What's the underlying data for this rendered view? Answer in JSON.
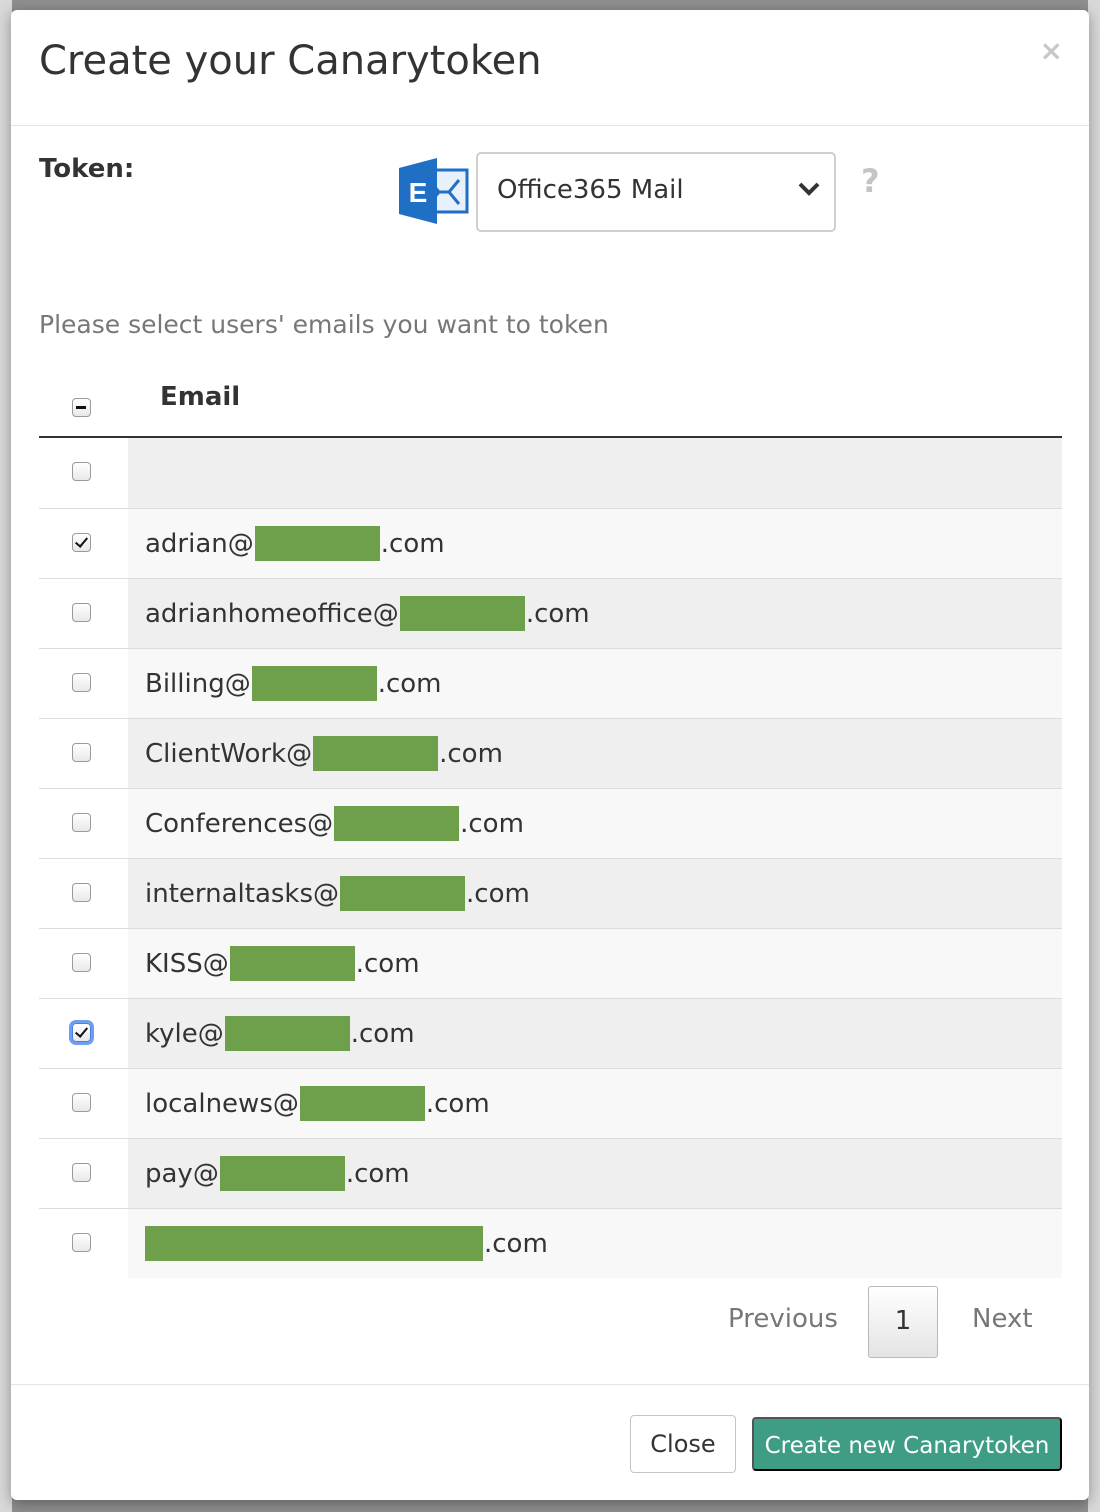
{
  "modal": {
    "title": "Create your Canarytoken",
    "close_glyph": "×"
  },
  "token": {
    "label": "Token:",
    "icon": "exchange-mail-icon",
    "selected": "Office365 Mail",
    "help_glyph": "?"
  },
  "instruction": "Please select users' emails you want to token",
  "table": {
    "header_email": "Email",
    "select_all_state": "indeterminate",
    "rows": [
      {
        "prefix": "",
        "suffix": "",
        "checked": false,
        "redacted": "none"
      },
      {
        "prefix": "adrian@",
        "suffix": ".com",
        "checked": true,
        "redacted": "short"
      },
      {
        "prefix": "adrianhomeoffice@",
        "suffix": ".com",
        "checked": false,
        "redacted": "short"
      },
      {
        "prefix": "Billing@",
        "suffix": ".com",
        "checked": false,
        "redacted": "short"
      },
      {
        "prefix": "ClientWork@",
        "suffix": ".com",
        "checked": false,
        "redacted": "short"
      },
      {
        "prefix": "Conferences@",
        "suffix": ".com",
        "checked": false,
        "redacted": "short"
      },
      {
        "prefix": "internaltasks@",
        "suffix": ".com",
        "checked": false,
        "redacted": "short"
      },
      {
        "prefix": "KISS@",
        "suffix": ".com",
        "checked": false,
        "redacted": "short"
      },
      {
        "prefix": "kyle@",
        "suffix": ".com",
        "checked": true,
        "focused": true,
        "redacted": "short"
      },
      {
        "prefix": "localnews@",
        "suffix": ".com",
        "checked": false,
        "redacted": "short"
      },
      {
        "prefix": "pay@",
        "suffix": ".com",
        "checked": false,
        "redacted": "short"
      },
      {
        "prefix": "",
        "suffix": ".com",
        "checked": false,
        "redacted": "long"
      }
    ]
  },
  "pager": {
    "previous": "Previous",
    "page": "1",
    "next": "Next"
  },
  "footer": {
    "close_label": "Close",
    "create_label": "Create new Canarytoken"
  },
  "colors": {
    "primary_button": "#3f9d86",
    "redaction": "#6ea04b",
    "exchange_blue": "#1f6fc5"
  }
}
